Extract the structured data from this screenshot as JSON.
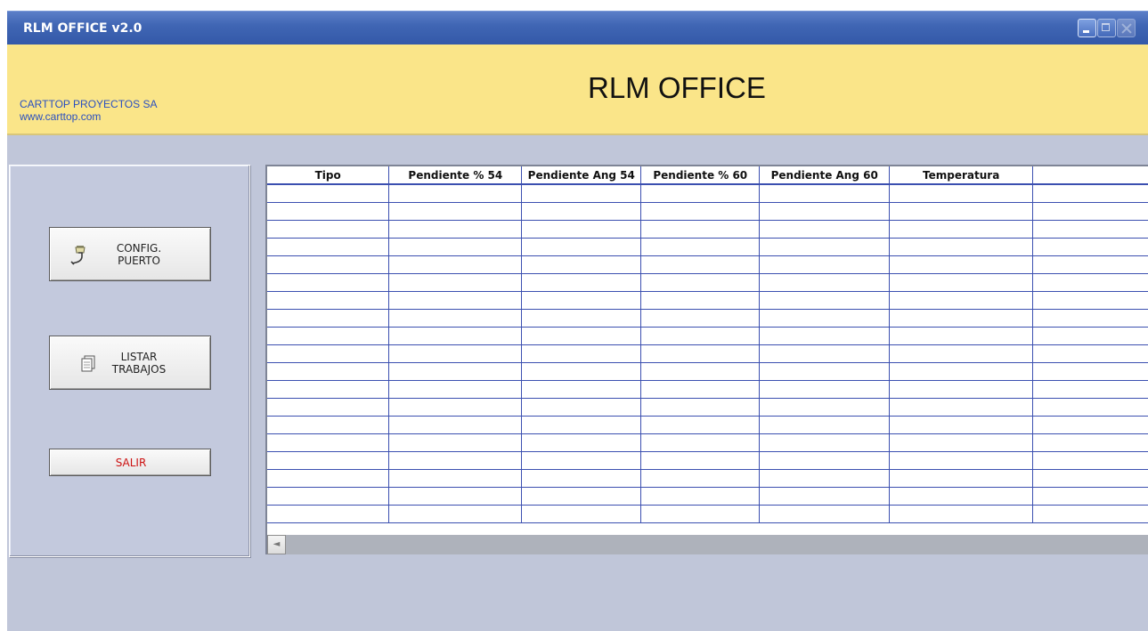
{
  "window": {
    "title": "RLM OFFICE v2.0"
  },
  "banner": {
    "company_name": "CARTTOP PROYECTOS SA",
    "company_url": "www.carttop.com",
    "app_title": "RLM OFFICE"
  },
  "sidebar": {
    "config_button": {
      "line1": "CONFIG.",
      "line2": "PUERTO",
      "icon": "plug-icon"
    },
    "listar_button": {
      "line1": "LISTAR",
      "line2": "TRABAJOS",
      "icon": "document-icon"
    },
    "salir_button": {
      "label": "SALIR",
      "color": "#cc1111"
    }
  },
  "table": {
    "columns": [
      "Tipo",
      "Pendiente % 54",
      "Pendiente Ang 54",
      "Pendiente % 60",
      "Pendiente Ang 60",
      "Temperatura",
      ""
    ],
    "rows": []
  },
  "scrollbar": {
    "left_arrow": "◄"
  },
  "colors": {
    "titlebar": "#4066b4",
    "banner": "#fae589",
    "background": "#c0c6d9",
    "grid_lines": "#3b4fb0"
  }
}
